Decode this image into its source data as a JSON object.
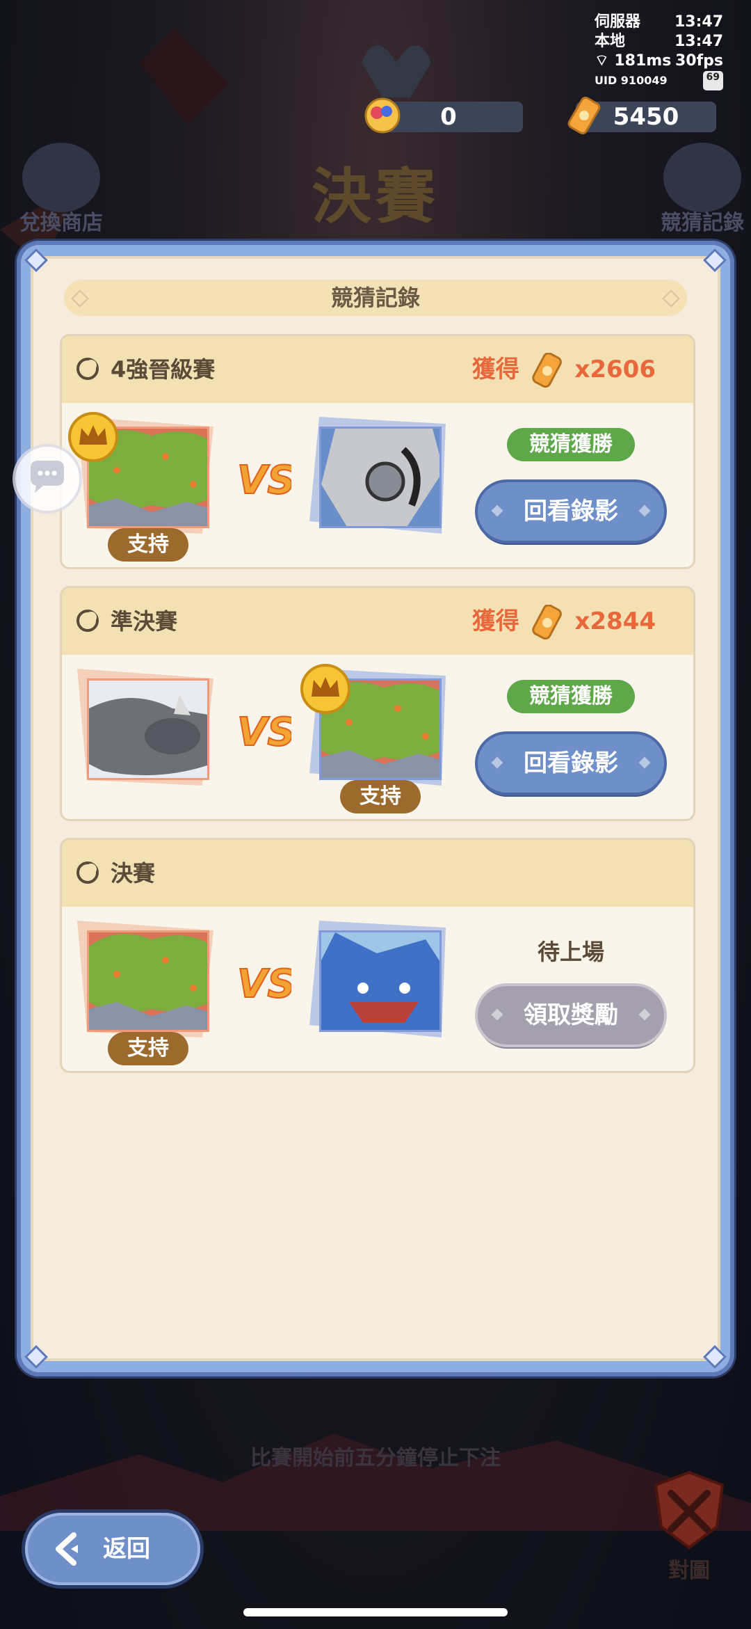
{
  "status_bar": {
    "server_label": "伺服器",
    "server_time": "13:47",
    "local_label": "本地",
    "local_time": "13:47",
    "ping": "181ms",
    "fps": "30fps",
    "uid": "UID 910049",
    "battery": "69"
  },
  "currencies": {
    "gems": "0",
    "tickets": "5450"
  },
  "background": {
    "title": "決賽",
    "shop_label": "兌換商店",
    "records_label": "競猜記錄",
    "footer_notice": "比賽開始前五分鐘停止下注",
    "map_label": "對圖"
  },
  "panel": {
    "title": "競猜記錄",
    "matches": [
      {
        "round": "4強晉級賽",
        "reward_prefix": "獲得",
        "reward_amount": "x2606",
        "support_label": "支持",
        "result": "競猜獲勝",
        "action": "回看錄影"
      },
      {
        "round": "準決賽",
        "reward_prefix": "獲得",
        "reward_amount": "x2844",
        "support_label": "支持",
        "result": "競猜獲勝",
        "action": "回看錄影"
      },
      {
        "round": "決賽",
        "support_label": "支持",
        "result": "待上場",
        "action": "領取獎勵"
      }
    ]
  },
  "back_button": "返回",
  "colors": {
    "accent_orange": "#e8673b",
    "win_green": "#5fa84a",
    "button_blue": "#6f8fc9",
    "support_brown": "#9c6a2c"
  }
}
